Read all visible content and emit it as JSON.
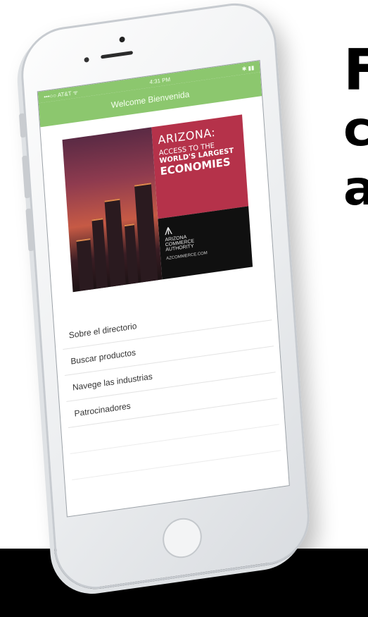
{
  "headline": {
    "line1": "F",
    "line2": "c",
    "line3": "a"
  },
  "status_bar": {
    "carrier": "•••○○ AT&T ᯤ",
    "time": "4:31 PM",
    "battery": "✱ ▮▮"
  },
  "nav": {
    "title": "Welcome Bienvenida"
  },
  "banner": {
    "line1": "ARIZONA:",
    "line2": "ACCESS TO THE",
    "line3": "WORLD'S LARGEST",
    "line4": "ECONOMIES",
    "org_line1": "ARIZONA",
    "org_line2": "COMMERCE",
    "org_line3": "AUTHORITY",
    "url": "AZCOMMERCE.COM"
  },
  "menu": {
    "items": [
      {
        "label": "Sobre el directorio"
      },
      {
        "label": "Buscar productos"
      },
      {
        "label": "Navege las industrias"
      },
      {
        "label": "Patrocinadores"
      }
    ]
  },
  "colors": {
    "nav_green": "#8cc76e",
    "banner_red": "#b5324a",
    "floor": "#000000"
  }
}
